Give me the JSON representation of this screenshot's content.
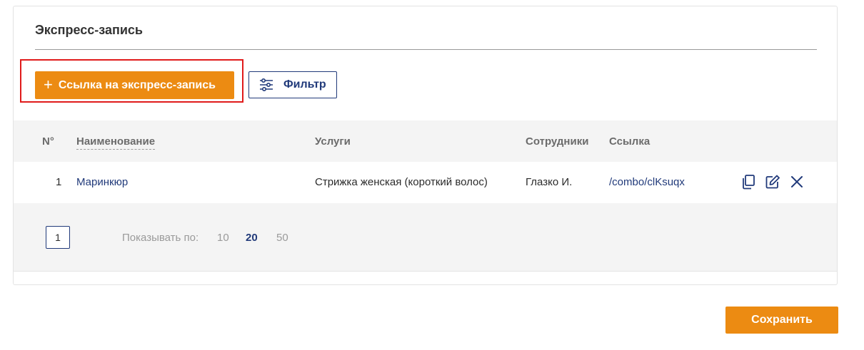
{
  "section": {
    "title": "Экспресс-запись"
  },
  "toolbar": {
    "add_label": "Ссылка на экспресс-запись",
    "add_icon": "plus-icon",
    "filter_label": "Фильтр",
    "filter_icon": "sliders-icon"
  },
  "table": {
    "headers": {
      "num": "N°",
      "name": "Наименование",
      "services": "Услуги",
      "staff": "Сотрудники",
      "link": "Ссылка"
    },
    "rows": [
      {
        "num": "1",
        "name": "Маринкюр",
        "services": "Стрижка женская (короткий волос)",
        "staff": "Глазко И.",
        "link": "/combo/clKsuqx",
        "actions": [
          "copy-icon",
          "edit-icon",
          "close-icon"
        ]
      }
    ]
  },
  "pagination": {
    "current_page": "1",
    "show_label": "Показывать по:",
    "sizes": [
      "10",
      "20",
      "50"
    ],
    "active_size": "20"
  },
  "footer": {
    "save_label": "Сохранить"
  },
  "colors": {
    "accent": "#ec8b12",
    "primary": "#213a7a",
    "highlight": "#e01b1b",
    "table_bg": "#f4f4f4"
  }
}
